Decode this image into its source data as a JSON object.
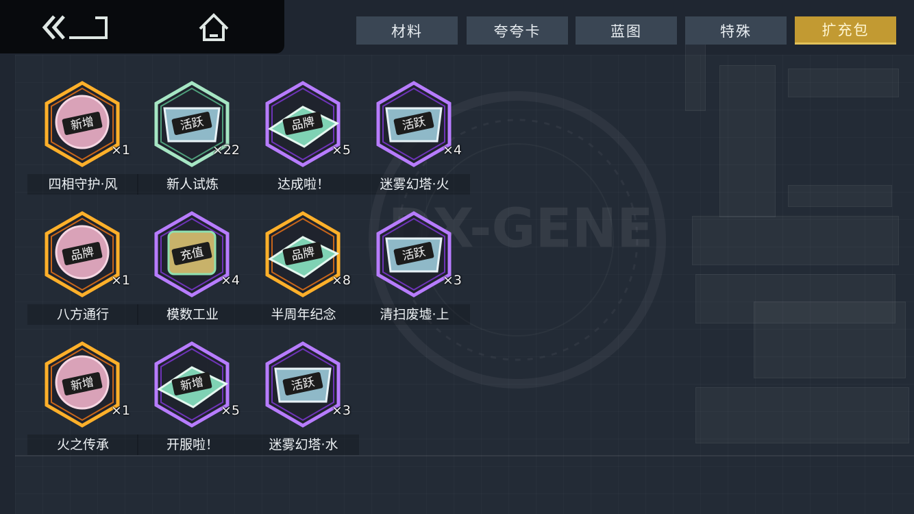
{
  "nav": {
    "back_icon": "double-chevron-back-icon",
    "home_icon": "home-icon"
  },
  "tabs": [
    {
      "label": "材料",
      "active": false
    },
    {
      "label": "夸夸卡",
      "active": false
    },
    {
      "label": "蓝图",
      "active": false
    },
    {
      "label": "特殊",
      "active": false
    },
    {
      "label": "扩充包",
      "active": true
    }
  ],
  "background": {
    "logo_text": "DX-GENE"
  },
  "colors": {
    "active_tab": "#c29a32",
    "frame_orange": "#f0a21e",
    "frame_purple": "#a05ee0",
    "frame_green": "#8fd6b0"
  },
  "items": [
    {
      "name": "四相守护·风",
      "qty": "×1",
      "stamp": "新增",
      "frame": "orange",
      "shape": "disc"
    },
    {
      "name": "新人试炼",
      "qty": "×22",
      "stamp": "活跃",
      "frame": "green",
      "shape": "chip"
    },
    {
      "name": "达成啦！",
      "qty": "×5",
      "stamp": "品牌",
      "frame": "purple",
      "shape": "card"
    },
    {
      "name": "迷雾幻塔·火",
      "qty": "×4",
      "stamp": "活跃",
      "frame": "purple",
      "shape": "chip"
    },
    {
      "name": "八方通行",
      "qty": "×1",
      "stamp": "品牌",
      "frame": "orange",
      "shape": "disc"
    },
    {
      "name": "模数工业",
      "qty": "×4",
      "stamp": "充值",
      "frame": "purple",
      "shape": "cube"
    },
    {
      "name": "半周年纪念",
      "qty": "×8",
      "stamp": "品牌",
      "frame": "orange",
      "shape": "card"
    },
    {
      "name": "清扫废墟·上",
      "qty": "×3",
      "stamp": "活跃",
      "frame": "purple",
      "shape": "chip"
    },
    {
      "name": "火之传承",
      "qty": "×1",
      "stamp": "新增",
      "frame": "orange",
      "shape": "disc"
    },
    {
      "name": "开服啦！",
      "qty": "×5",
      "stamp": "新增",
      "frame": "purple",
      "shape": "card"
    },
    {
      "name": "迷雾幻塔·水",
      "qty": "×3",
      "stamp": "活跃",
      "frame": "purple",
      "shape": "chip"
    }
  ]
}
